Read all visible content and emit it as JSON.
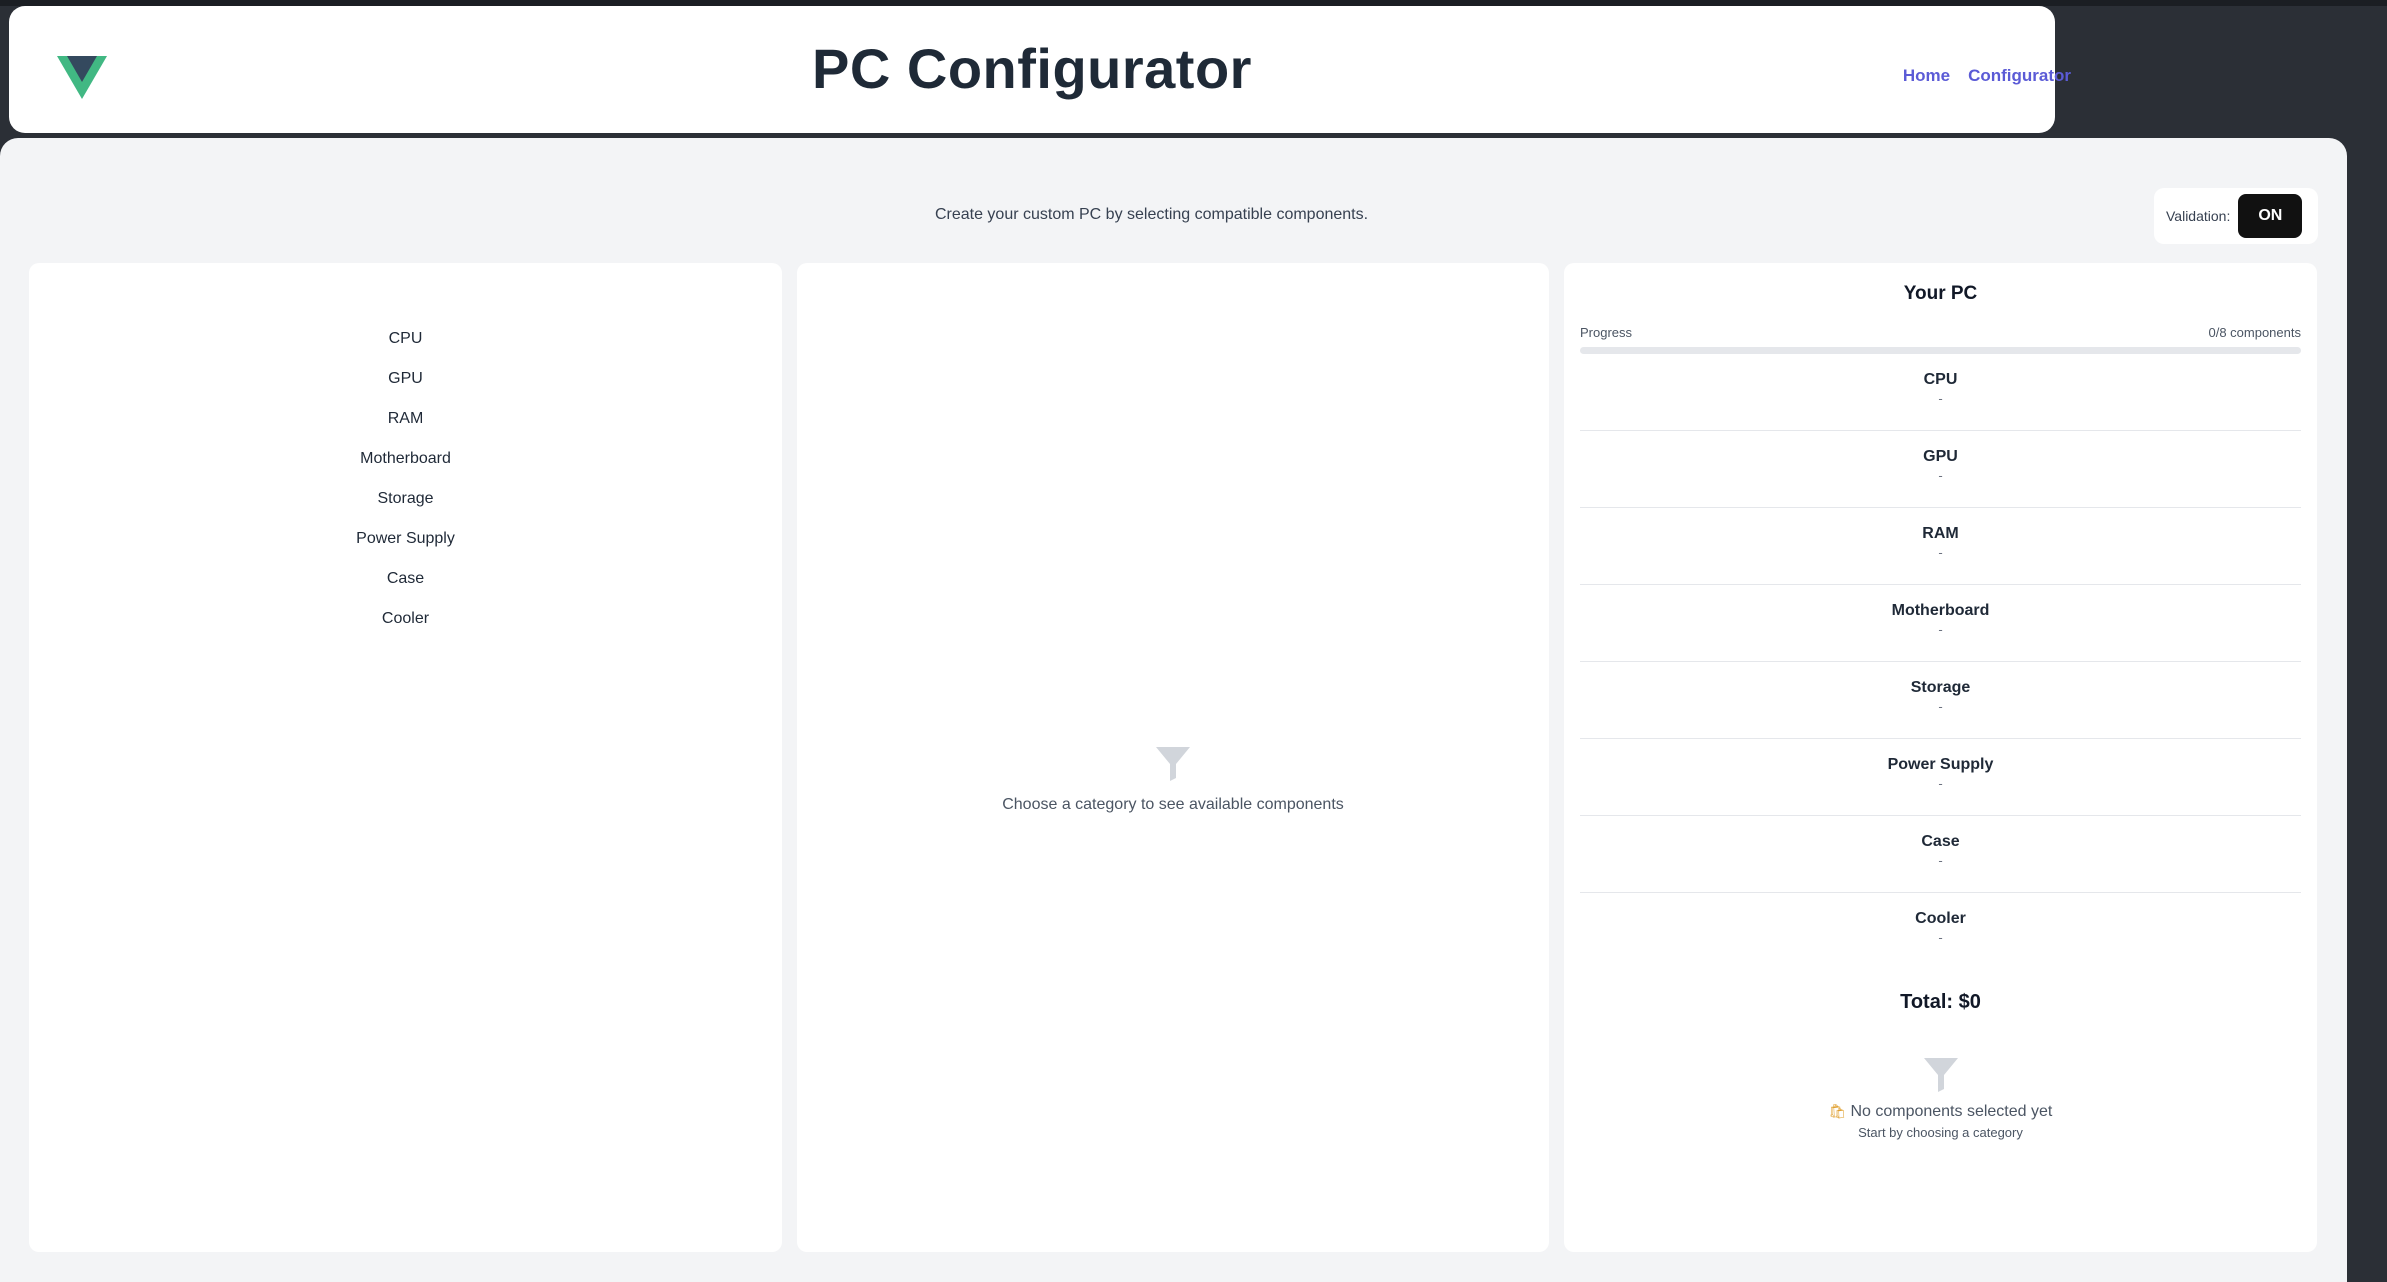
{
  "header": {
    "title": "PC Configurator",
    "nav": [
      "Home",
      "Configurator"
    ],
    "logo_colors": {
      "outer": "#41b883",
      "inner": "#34495e"
    }
  },
  "toolbar": {
    "subtitle": "Create your custom PC by selecting compatible components.",
    "validation_label": "Validation:",
    "validation_state": "ON"
  },
  "categories": [
    "CPU",
    "GPU",
    "RAM",
    "Motherboard",
    "Storage",
    "Power Supply",
    "Case",
    "Cooler"
  ],
  "middle": {
    "empty_message": "Choose a category to see available components"
  },
  "summary": {
    "title": "Your PC",
    "progress_label": "Progress",
    "progress_count": "0/8 components",
    "progress_fraction": 0,
    "slots": [
      {
        "name": "CPU",
        "value": "-"
      },
      {
        "name": "GPU",
        "value": "-"
      },
      {
        "name": "RAM",
        "value": "-"
      },
      {
        "name": "Motherboard",
        "value": "-"
      },
      {
        "name": "Storage",
        "value": "-"
      },
      {
        "name": "Power Supply",
        "value": "-"
      },
      {
        "name": "Case",
        "value": "-"
      },
      {
        "name": "Cooler",
        "value": "-"
      }
    ],
    "total": "Total: $0",
    "empty_title": "No components selected yet",
    "empty_hint": "Start by choosing a category"
  }
}
